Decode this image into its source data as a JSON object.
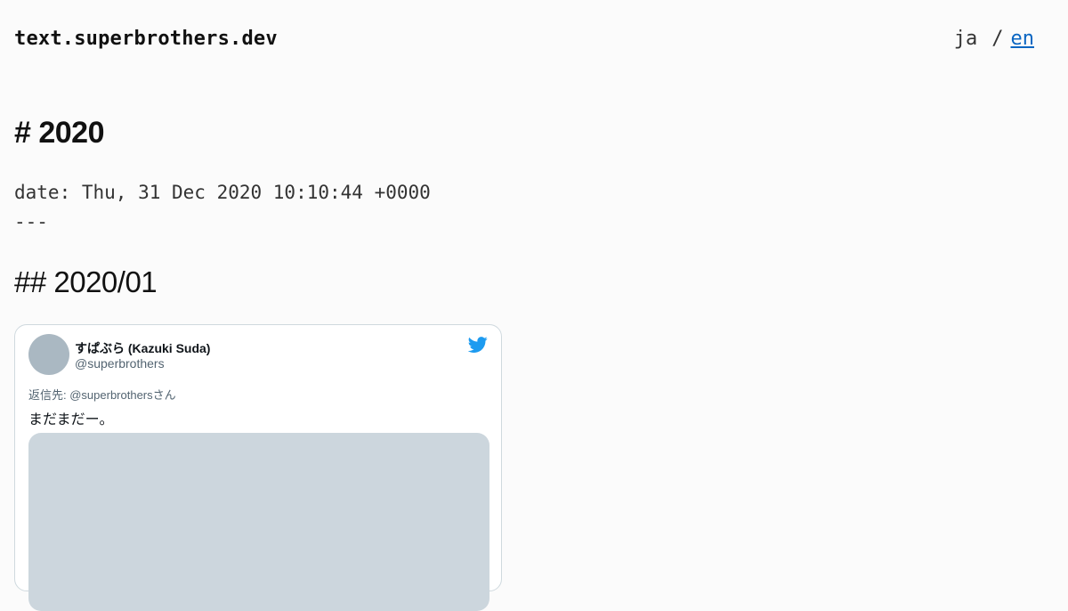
{
  "site": {
    "title": "text.superbrothers.dev"
  },
  "lang": {
    "current": "ja",
    "separator": "/",
    "other": "en"
  },
  "post": {
    "heading": "# 2020",
    "meta_date": "date: Thu, 31 Dec 2020 10:10:44 +0000",
    "meta_rule": "---",
    "section_heading": "## 2020/01"
  },
  "tweet": {
    "author_name": "すぱぶら (Kazuki Suda)",
    "author_handle": "@superbrothers",
    "reply_to": "返信先: @superbrothersさん",
    "text": "まだまだー。",
    "brand_color": "#1d9bf0",
    "icon": "twitter-bird-icon"
  }
}
